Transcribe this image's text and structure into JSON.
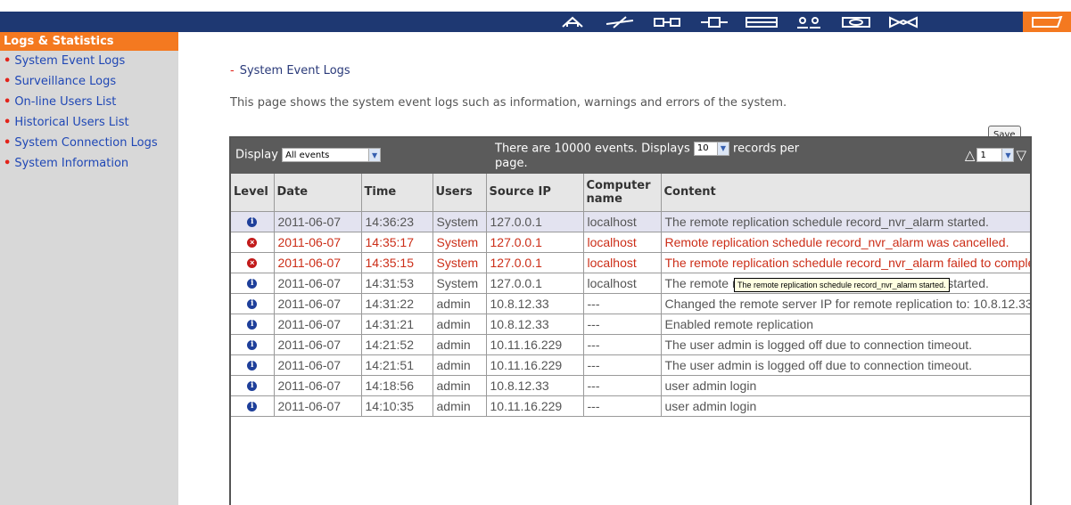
{
  "sidebar": {
    "title": "Logs & Statistics",
    "items": [
      {
        "label": "System Event Logs"
      },
      {
        "label": "Surveillance Logs"
      },
      {
        "label": "On-line Users List"
      },
      {
        "label": "Historical Users List"
      },
      {
        "label": "System Connection Logs"
      },
      {
        "label": "System Information"
      }
    ]
  },
  "topbar": {
    "icons": [
      "home-icon",
      "network-icon",
      "device-icon",
      "plugin-icon",
      "storage-icon",
      "users-icon",
      "disk-icon",
      "network-services-icon",
      "logs-icon"
    ]
  },
  "main": {
    "breadcrumb": "System Event Logs",
    "description": "This page shows the system event logs such as information, warnings and errors of the system.",
    "save_label": "Save"
  },
  "table": {
    "display_label": "Display",
    "display_value": "All events",
    "info_prefix": "There are 10000 events.  Displays",
    "records_value": "10",
    "info_suffix": "records per page.",
    "page_value": "1",
    "headers": {
      "level": "Level",
      "date": "Date",
      "time": "Time",
      "users": "Users",
      "source_ip": "Source IP",
      "computer": "Computer name",
      "content": "Content"
    },
    "rows": [
      {
        "level": "info",
        "date": "2011-06-07",
        "time": "14:36:23",
        "users": "System",
        "ip": "127.0.0.1",
        "computer": "localhost",
        "content": "The remote replication schedule record_nvr_alarm started."
      },
      {
        "level": "error",
        "date": "2011-06-07",
        "time": "14:35:17",
        "users": "System",
        "ip": "127.0.0.1",
        "computer": "localhost",
        "content": "Remote replication schedule record_nvr_alarm was cancelled."
      },
      {
        "level": "error",
        "date": "2011-06-07",
        "time": "14:35:15",
        "users": "System",
        "ip": "127.0.0.1",
        "computer": "localhost",
        "content": "The remote replication schedule record_nvr_alarm failed to complete."
      },
      {
        "level": "info",
        "date": "2011-06-07",
        "time": "14:31:53",
        "users": "System",
        "ip": "127.0.0.1",
        "computer": "localhost",
        "content": "The remote replication schedule record_nvr_alarm started."
      },
      {
        "level": "info",
        "date": "2011-06-07",
        "time": "14:31:22",
        "users": "admin",
        "ip": "10.8.12.33",
        "computer": "---",
        "content": "Changed the remote server IP for remote replication to: 10.8.12.33"
      },
      {
        "level": "info",
        "date": "2011-06-07",
        "time": "14:31:21",
        "users": "admin",
        "ip": "10.8.12.33",
        "computer": "---",
        "content": "Enabled remote replication"
      },
      {
        "level": "info",
        "date": "2011-06-07",
        "time": "14:21:52",
        "users": "admin",
        "ip": "10.11.16.229",
        "computer": "---",
        "content": "The user admin is logged off due to connection timeout."
      },
      {
        "level": "info",
        "date": "2011-06-07",
        "time": "14:21:51",
        "users": "admin",
        "ip": "10.11.16.229",
        "computer": "---",
        "content": "The user admin is logged off due to connection timeout."
      },
      {
        "level": "info",
        "date": "2011-06-07",
        "time": "14:18:56",
        "users": "admin",
        "ip": "10.8.12.33",
        "computer": "---",
        "content": "user admin login"
      },
      {
        "level": "info",
        "date": "2011-06-07",
        "time": "14:10:35",
        "users": "admin",
        "ip": "10.11.16.229",
        "computer": "---",
        "content": "user admin login"
      }
    ]
  },
  "tooltip": "The remote replication schedule record_nvr_alarm started.",
  "colors": {
    "topbar": "#1e3872",
    "accent": "#f47920",
    "sidebar_bg": "#d8d8d8",
    "link": "#1f47b5",
    "error_text": "#cc2e18",
    "panel_header": "#5b5b5b"
  }
}
